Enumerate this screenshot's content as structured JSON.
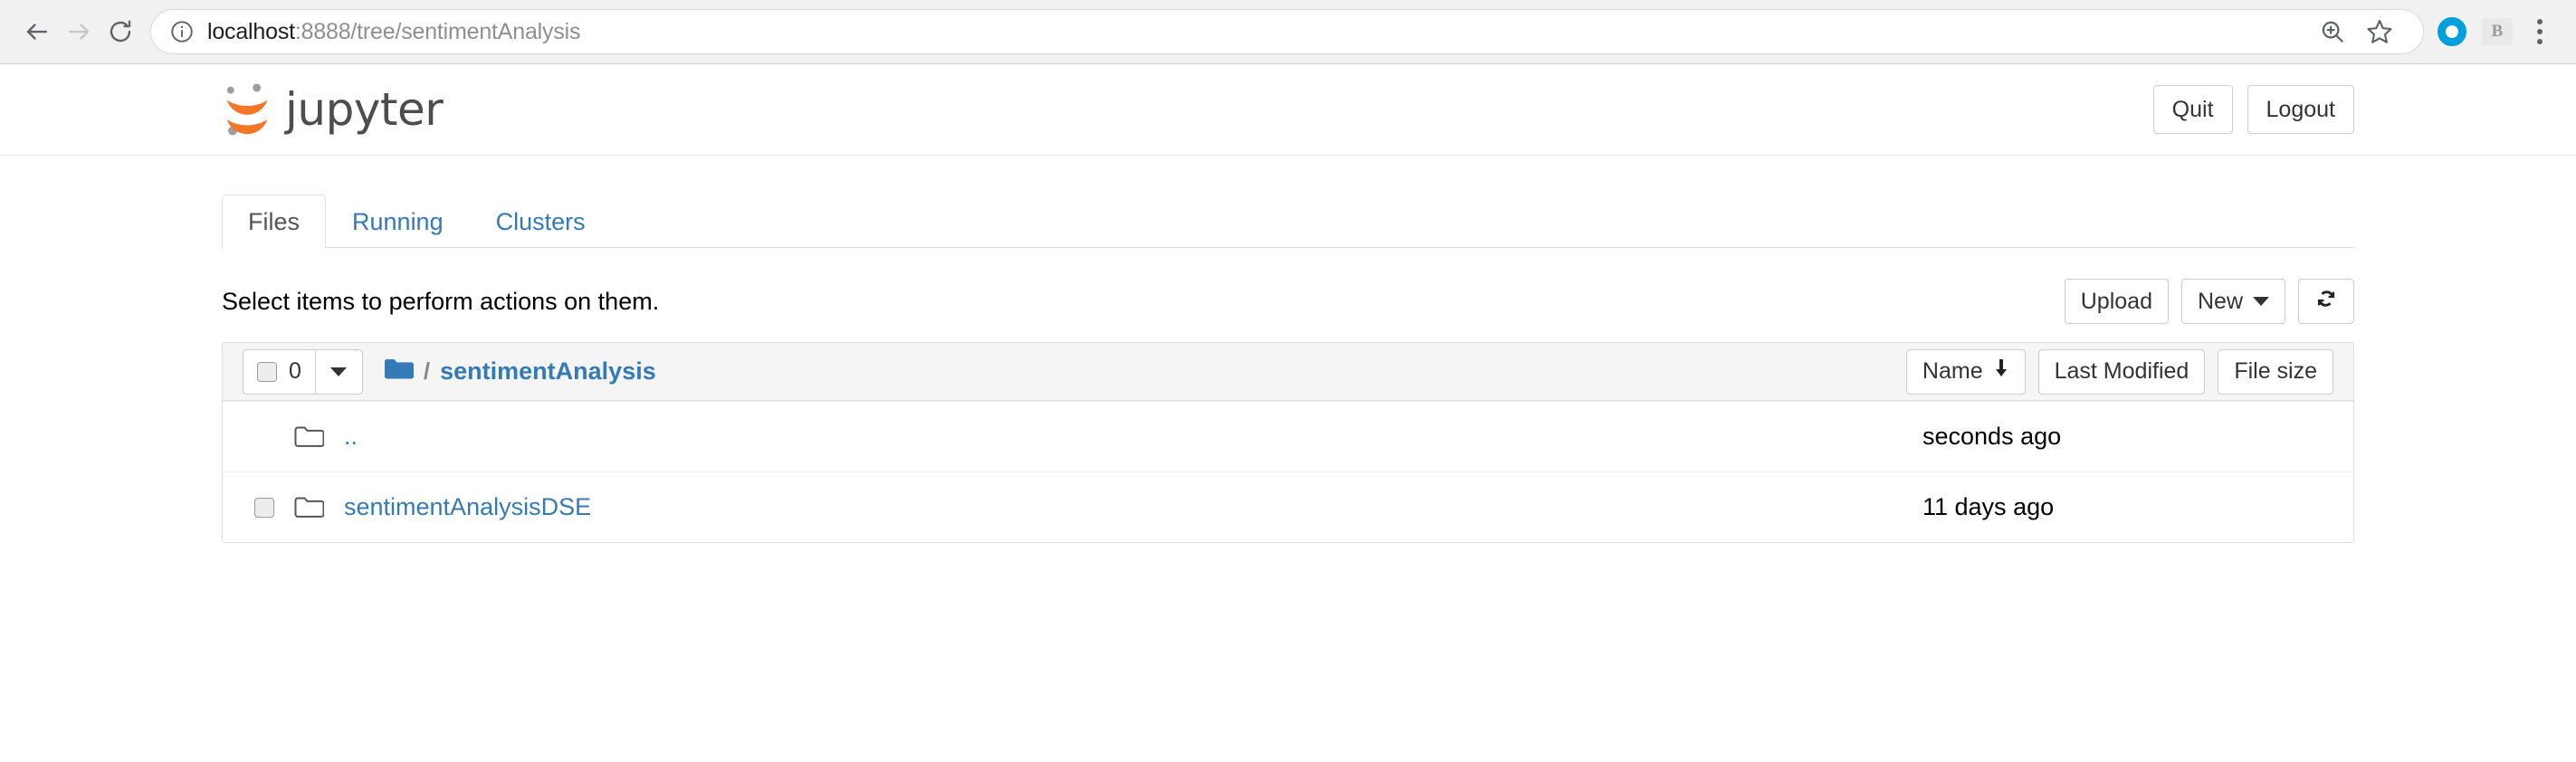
{
  "browser": {
    "back_icon": "back-arrow-icon",
    "forward_icon": "forward-arrow-icon",
    "reload_icon": "reload-icon",
    "info_icon": "info-circle-icon",
    "url_host": "localhost",
    "url_rest": ":8888/tree/sentimentAnalysis",
    "url_full": "localhost:8888/tree/sentimentAnalysis",
    "zoom_icon": "zoom-in-magnifier-icon",
    "bookmark_icon": "star-bookmark-icon",
    "extension_one_icon": "blue-circle-extension-icon",
    "extension_two_label": "B",
    "menu_icon": "three-dot-menu-icon"
  },
  "header": {
    "logo_text": "jupyter",
    "logo_color": "#f37726",
    "quit_label": "Quit",
    "logout_label": "Logout"
  },
  "tabs": [
    {
      "label": "Files",
      "active": true
    },
    {
      "label": "Running",
      "active": false
    },
    {
      "label": "Clusters",
      "active": false
    }
  ],
  "actions": {
    "hint": "Select items to perform actions on them.",
    "upload_label": "Upload",
    "new_label": "New",
    "refresh_icon": "refresh-icon"
  },
  "filelist": {
    "selected_count": "0",
    "select_all_icon": "checkbox-icon",
    "select_dropdown_icon": "caret-down-icon",
    "folder_icon": "folder-solid-icon",
    "path_separator": "/",
    "current_folder": "sentimentAnalysis",
    "sort": {
      "name_label": "Name",
      "name_sort_icon": "arrow-down-icon",
      "modified_label": "Last Modified",
      "size_label": "File size"
    },
    "rows": [
      {
        "name": "..",
        "icon": "folder-outline-icon",
        "modified": "seconds ago",
        "size": "",
        "has_checkbox": false
      },
      {
        "name": "sentimentAnalysisDSE",
        "icon": "folder-outline-icon",
        "modified": "11 days ago",
        "size": "",
        "has_checkbox": true
      }
    ]
  },
  "colors": {
    "link_blue": "#337ab7",
    "jupyter_orange": "#f37726",
    "header_gray": "#f5f5f5"
  }
}
